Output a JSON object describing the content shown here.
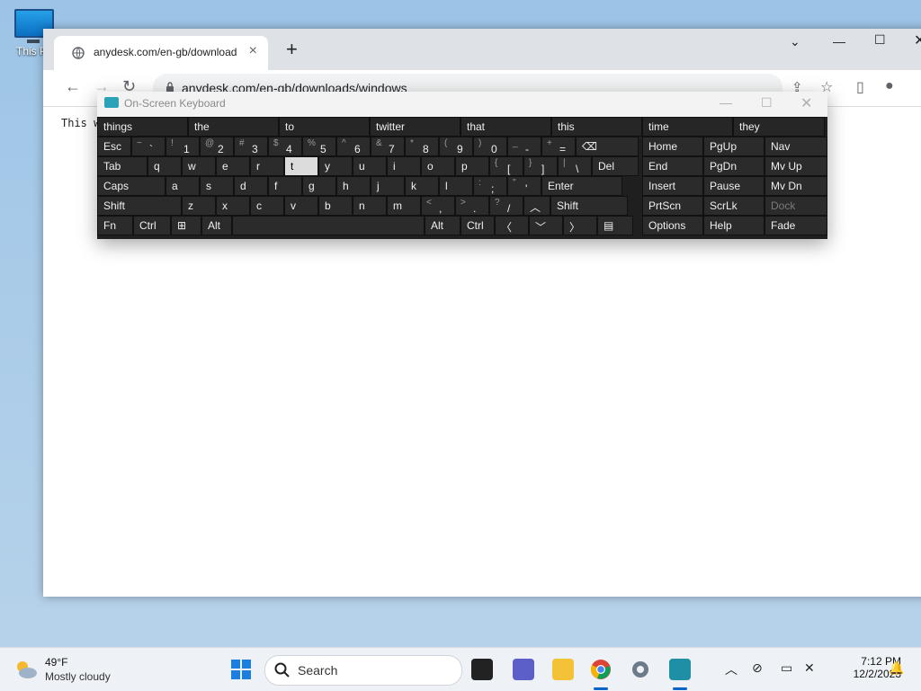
{
  "desktop": {
    "icon_label": "This PC"
  },
  "browser": {
    "tab_title": "anydesk.com/en-gb/downloads/windows",
    "new_tab_symbol": "+",
    "url": "anydesk.com/en-gb/downloads/windows",
    "page_text": "This w"
  },
  "osk": {
    "title": "On-Screen Keyboard",
    "predictions": [
      "things",
      "the",
      "to",
      "twitter",
      "that",
      "this",
      "time",
      "they"
    ],
    "rows": {
      "r1_main": [
        {
          "m": "Esc"
        },
        {
          "s": "~",
          "b": "`"
        },
        {
          "s": "!",
          "b": "1"
        },
        {
          "s": "@",
          "b": "2"
        },
        {
          "s": "#",
          "b": "3"
        },
        {
          "s": "$",
          "b": "4"
        },
        {
          "s": "%",
          "b": "5"
        },
        {
          "s": "^",
          "b": "6"
        },
        {
          "s": "&",
          "b": "7"
        },
        {
          "s": "*",
          "b": "8"
        },
        {
          "s": "(",
          "b": "9"
        },
        {
          "s": ")",
          "b": "0"
        },
        {
          "s": "_",
          "b": "-"
        },
        {
          "s": "+",
          "b": "="
        }
      ],
      "r2_main": [
        {
          "m": "Tab"
        },
        {
          "m": "q"
        },
        {
          "m": "w"
        },
        {
          "m": "e"
        },
        {
          "m": "r"
        },
        {
          "m": "t"
        },
        {
          "m": "y"
        },
        {
          "m": "u"
        },
        {
          "m": "i"
        },
        {
          "m": "o"
        },
        {
          "m": "p"
        },
        {
          "s": "{",
          "b": "["
        },
        {
          "s": "}",
          "b": "]"
        },
        {
          "s": "|",
          "b": "\\"
        },
        {
          "m": "Del"
        }
      ],
      "r3_main": [
        {
          "m": "Caps"
        },
        {
          "m": "a"
        },
        {
          "m": "s"
        },
        {
          "m": "d"
        },
        {
          "m": "f"
        },
        {
          "m": "g"
        },
        {
          "m": "h"
        },
        {
          "m": "j"
        },
        {
          "m": "k"
        },
        {
          "m": "l"
        },
        {
          "s": ":",
          "b": ";"
        },
        {
          "s": "\"",
          "b": "'"
        },
        {
          "m": "Enter"
        }
      ],
      "r4_main": [
        {
          "m": "Shift"
        },
        {
          "m": "z"
        },
        {
          "m": "x"
        },
        {
          "m": "c"
        },
        {
          "m": "v"
        },
        {
          "m": "b"
        },
        {
          "m": "n"
        },
        {
          "m": "m"
        },
        {
          "s": "<",
          "b": ","
        },
        {
          "s": ">",
          "b": "."
        },
        {
          "s": "?",
          "b": "/"
        },
        {
          "m": "Shift"
        }
      ],
      "r5_main": [
        {
          "m": "Fn"
        },
        {
          "m": "Ctrl"
        },
        {
          "m": "Alt"
        },
        {
          "m": "Alt"
        },
        {
          "m": "Ctrl"
        }
      ]
    },
    "nav": {
      "home": "Home",
      "pgup": "PgUp",
      "navbtn": "Nav",
      "end": "End",
      "pgdn": "PgDn",
      "mvup": "Mv Up",
      "insert": "Insert",
      "pause": "Pause",
      "mvdn": "Mv Dn",
      "prtscn": "PrtScn",
      "scrlk": "ScrLk",
      "dock": "Dock",
      "options": "Options",
      "help": "Help",
      "fade": "Fade"
    }
  },
  "taskbar": {
    "temp": "49°F",
    "condition": "Mostly cloudy",
    "search_label": "Search",
    "time": "7:12 PM",
    "date": "12/2/2023"
  }
}
